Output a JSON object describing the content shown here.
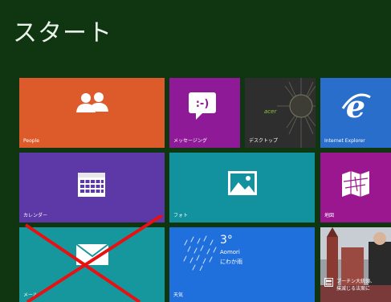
{
  "header": {
    "title": "スタート"
  },
  "tiles": {
    "people": {
      "label": "People",
      "color": "#dd5a2b",
      "icon": "people-icon"
    },
    "messaging": {
      "label": "メッセージング",
      "color": "#8f1a98",
      "icon": "messaging-icon",
      "icon_text": ":-)"
    },
    "desktop": {
      "label": "デスクトップ",
      "color": "#3a3a3a",
      "brand": "acer"
    },
    "ie": {
      "label": "Internet Explorer",
      "color": "#2a6ecb",
      "icon": "ie-icon"
    },
    "calendar": {
      "label": "カレンダー",
      "color": "#5d39a8",
      "icon": "calendar-icon"
    },
    "photos": {
      "label": "フォト",
      "color": "#11929e",
      "icon": "photo-icon"
    },
    "maps": {
      "label": "地図",
      "color": "#9b178f",
      "icon": "map-icon"
    },
    "mail": {
      "label": "メール",
      "color": "#16979d",
      "icon": "mail-icon"
    },
    "weather": {
      "label": "天気",
      "color": "#1f6fdc",
      "temperature": "3°",
      "city": "Aomori",
      "condition": "にわか雨"
    },
    "news": {
      "color": "#6b5f5b",
      "headline_line1": "プーチン大統領、",
      "headline_line2": "撲滅じる法案に"
    }
  },
  "overlay": {
    "color": "#e81010"
  }
}
